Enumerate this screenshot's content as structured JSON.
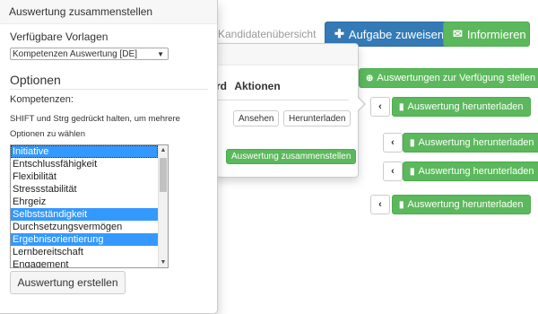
{
  "header": {
    "tab_label": "Kandidatenübersicht",
    "assign_label": "Aufgabe zuweisen",
    "info_label": "Informieren"
  },
  "right_panel": {
    "available_label": "Auswertungen zur Verfügung stellen",
    "download_label": "Auswertung herunterladen"
  },
  "middle_popover": {
    "col_partial": "rd",
    "col_actions": "Aktionen",
    "view_label": "Ansehen",
    "download_label": "Herunterladen",
    "compose_label": "Auswertung zusammenstellen"
  },
  "dialog": {
    "title": "Auswertung zusammenstellen",
    "templates_label": "Verfügbare Vorlagen",
    "template_selected": "Kompetenzen Auswertung [DE]",
    "options_heading": "Optionen",
    "competencies_label": "Kompetenzen:",
    "help_text": "SHIFT und Strg gedrückt halten, um mehrere Optionen zu wählen",
    "competencies": [
      {
        "label": "Initiative",
        "selected": true
      },
      {
        "label": "Entschlussfähigkeit",
        "selected": false
      },
      {
        "label": "Flexibilität",
        "selected": false
      },
      {
        "label": "Stressstabilität",
        "selected": false
      },
      {
        "label": "Ehrgeiz",
        "selected": false
      },
      {
        "label": "Selbstständigkeit",
        "selected": true
      },
      {
        "label": "Durchsetzungsvermögen",
        "selected": false
      },
      {
        "label": "Ergebnisorientierung",
        "selected": true
      },
      {
        "label": "Lernbereitschaft",
        "selected": false
      },
      {
        "label": "Engagement",
        "selected": false
      }
    ],
    "create_label": "Auswertung erstellen"
  },
  "colors": {
    "primary": "#337ab7",
    "success": "#5cb85c",
    "selection": "#3399ff"
  }
}
